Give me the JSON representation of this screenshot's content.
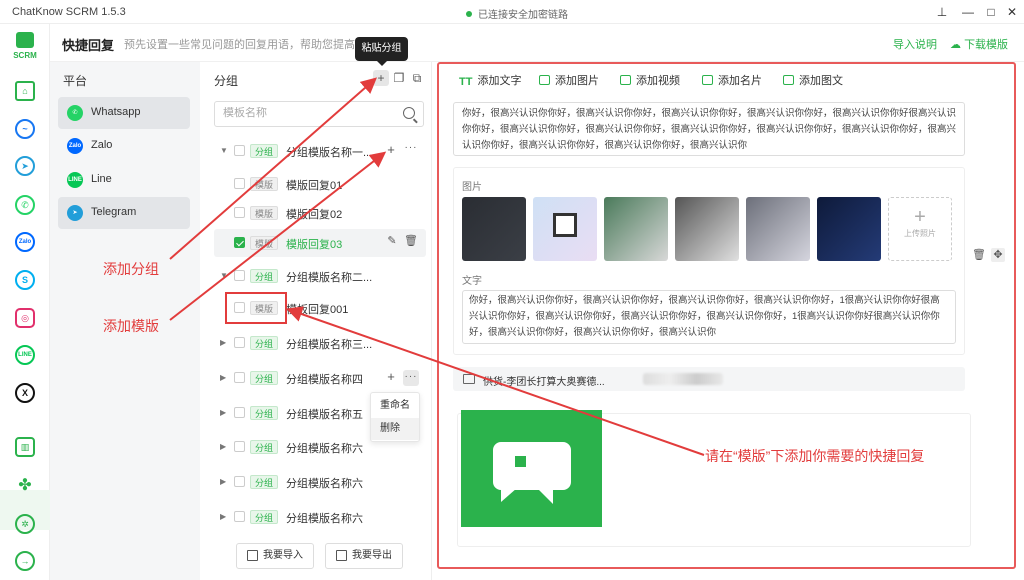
{
  "window": {
    "app_title": "ChatKnow SCRM 1.5.3",
    "connection_status": "已连接安全加密链路",
    "accent": "#2bb24c"
  },
  "rail": {
    "logo_text": "SCRM",
    "icons": [
      "home-icon",
      "messenger-icon",
      "telegram-icon",
      "whatsapp-icon",
      "zalo-icon",
      "skype-icon",
      "instagram-icon",
      "line-icon",
      "x-icon",
      "stats-icon",
      "quick-reply-icon",
      "settings-icon",
      "logout-icon"
    ]
  },
  "header": {
    "title": "快捷回复",
    "description": "预先设置一些常见问题的回复用语，帮助您提高回复",
    "import_help": "导入说明",
    "download_template": "下载模版"
  },
  "platform": {
    "header": "平台",
    "items": [
      {
        "label": "Whatsapp",
        "icon": "whatsapp-icon",
        "color": "#25d366",
        "active": true
      },
      {
        "label": "Zalo",
        "icon": "zalo-icon",
        "color": "#0068ff",
        "active": false
      },
      {
        "label": "Line",
        "icon": "line-icon",
        "color": "#06c755",
        "active": false
      },
      {
        "label": "Telegram",
        "icon": "telegram-icon",
        "color": "#229ed9",
        "active": false
      }
    ]
  },
  "groups": {
    "header": "分组",
    "tooltip": "粘贴分组",
    "search_placeholder": "模板名称",
    "tag_group": "分组",
    "tag_template": "模版",
    "rows": [
      {
        "kind": "group",
        "name": "分组模版名称一...",
        "expanded": true
      },
      {
        "kind": "template",
        "name": "模版回复01"
      },
      {
        "kind": "template",
        "name": "模版回复02"
      },
      {
        "kind": "template",
        "name": "模版回复03",
        "checked": true
      },
      {
        "kind": "group",
        "name": "分组模版名称二...",
        "expanded": true
      },
      {
        "kind": "template",
        "name": "模板回复001"
      },
      {
        "kind": "group",
        "name": "分组模版名称三..."
      },
      {
        "kind": "group",
        "name": "分组模版名称四"
      },
      {
        "kind": "group",
        "name": "分组模版名称五"
      },
      {
        "kind": "group",
        "name": "分组模版名称六"
      },
      {
        "kind": "group",
        "name": "分组模版名称六"
      },
      {
        "kind": "group",
        "name": "分组模版名称六"
      }
    ],
    "context_menu": [
      "重命名",
      "删除"
    ],
    "import_label": "我要导入",
    "export_label": "我要导出"
  },
  "editor": {
    "toolbar": [
      "添加文字",
      "添加图片",
      "添加视频",
      "添加名片",
      "添加图文"
    ],
    "text_content": "你好，很高兴认识你你好，很高兴认识你你好，很高兴认识你你好，很高兴认识你你好，很高兴认识你你好很高兴认识你你好，很高兴认识你你好，很高兴认识你你好，很高兴认识你你好，很高兴认识你你好，很高兴认识你你好，很高兴认识你你好，很高兴认识你你好，很高兴认识你你好，很高兴认识你",
    "image_label": "图片",
    "upload_label": "上传照片",
    "text_label": "文字",
    "text_content_2": "你好，很高兴认识你你好，很高兴认识你你好，很高兴认识你你好，很高兴认识你你好，1很高兴认识你你好很高兴认识你你好，很高兴认识你你好，很高兴认识你你好，很高兴认识你你好，1很高兴认识你你好很高兴认识你你好，很高兴认识你你好，很高兴认识你你好，很高兴认识你",
    "contact_name": "供货-李团长打算大奥赛德..."
  },
  "annotations": {
    "add_group": "添加分组",
    "add_template": "添加模版",
    "hint": "请在“模版”下添加你需要的快捷回复",
    "color": "#e23c3c"
  }
}
